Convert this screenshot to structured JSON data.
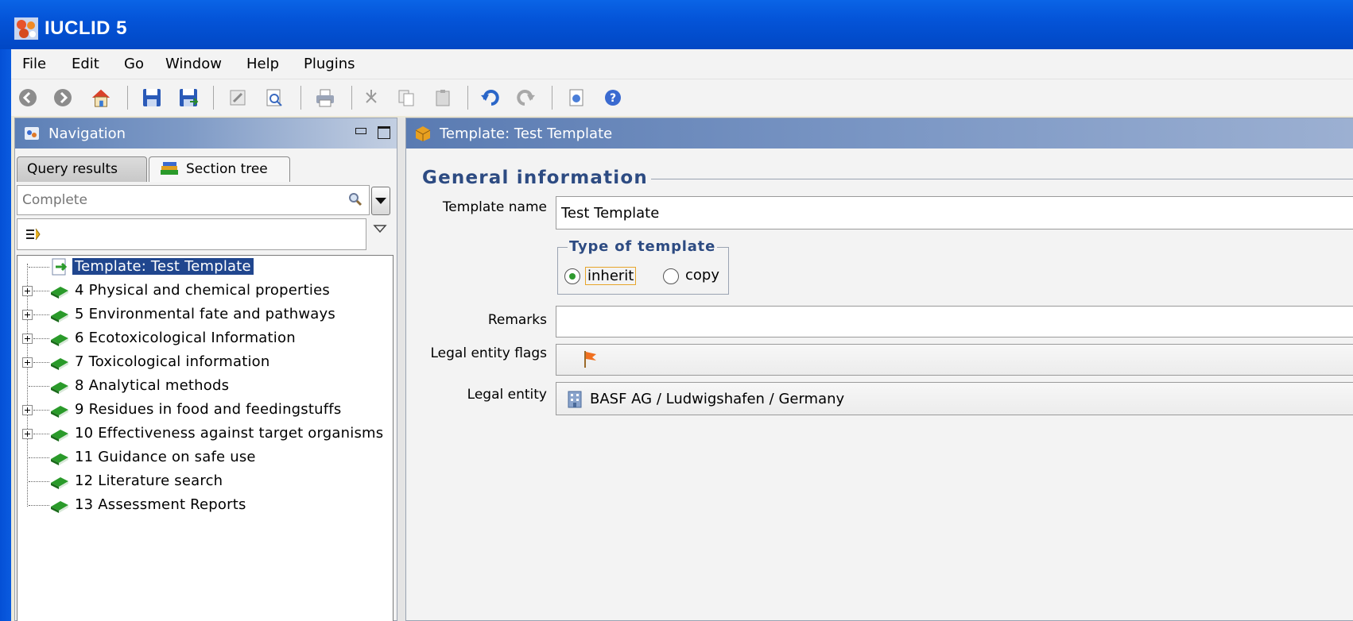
{
  "window": {
    "title": "IUCLID 5"
  },
  "menu": [
    "File",
    "Edit",
    "Go",
    "Window",
    "Help",
    "Plugins"
  ],
  "toolbar": {
    "icons": [
      "back-icon",
      "forward-icon",
      "home-icon",
      "save-icon",
      "save-all-icon",
      "edit-icon",
      "preview-icon",
      "print-icon",
      "cut-icon",
      "copy-icon",
      "paste-icon",
      "undo-icon",
      "redo-icon",
      "info-icon",
      "help-icon"
    ]
  },
  "navigation": {
    "title": "Navigation",
    "tabs": [
      "Query results",
      "Section tree"
    ],
    "active_tab": "Section tree",
    "filter_placeholder": "Complete",
    "tree": [
      {
        "label": "Template: Test Template",
        "selected": true,
        "expandable": false
      },
      {
        "label": "4 Physical and chemical properties",
        "expandable": true
      },
      {
        "label": "5 Environmental fate and pathways",
        "expandable": true
      },
      {
        "label": "6 Ecotoxicological Information",
        "expandable": true
      },
      {
        "label": "7 Toxicological information",
        "expandable": true
      },
      {
        "label": "8 Analytical methods",
        "expandable": false
      },
      {
        "label": "9 Residues in food and feedingstuffs",
        "expandable": true
      },
      {
        "label": "10 Effectiveness against target organisms",
        "expandable": true
      },
      {
        "label": "11 Guidance on safe use",
        "expandable": false
      },
      {
        "label": "12 Literature search",
        "expandable": false
      },
      {
        "label": "13 Assessment Reports",
        "expandable": false
      }
    ]
  },
  "main": {
    "title": "Template: Test Template",
    "section_title": "General information",
    "fields": {
      "template_name_label": "Template name",
      "template_name_value": "Test Template",
      "type_group_title": "Type of template",
      "type_options": [
        "inherit",
        "copy"
      ],
      "type_selected": "inherit",
      "remarks_label": "Remarks",
      "remarks_value": "",
      "legal_entity_flags_label": "Legal entity flags",
      "legal_entity_label": "Legal entity",
      "legal_entity_value": "BASF AG / Ludwigshafen / Germany"
    }
  }
}
